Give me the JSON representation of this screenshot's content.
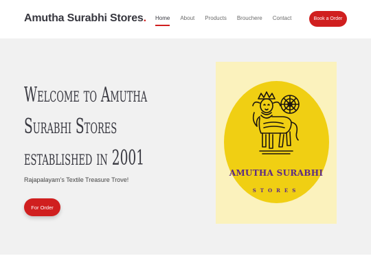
{
  "header": {
    "brand": "Amutha Surabhi Stores",
    "brand_dot": ".",
    "nav": [
      {
        "label": "Home",
        "active": true
      },
      {
        "label": "About",
        "active": false
      },
      {
        "label": "Products",
        "active": false
      },
      {
        "label": "Brouchere",
        "active": false
      },
      {
        "label": "Contact",
        "active": false
      }
    ],
    "book_button": "Book a Order"
  },
  "hero": {
    "title_lines": [
      "Welcome to Amutha",
      "Surabhi Stores",
      "established in 2001"
    ],
    "subtitle": "Rajapalayam’s Textile Treasure Trove!",
    "order_button": "For Order"
  },
  "logo": {
    "line1": "AMUTHA SURABHI",
    "line2": "STORES",
    "icon": "kamadhenu-cow-icon"
  },
  "colors": {
    "accent": "#d01f1f",
    "hero_bg": "#f1f1f1",
    "logo_circle": "#f0cf13",
    "logo_bg": "#fbf2bd",
    "logo_text": "#5b2a86"
  }
}
